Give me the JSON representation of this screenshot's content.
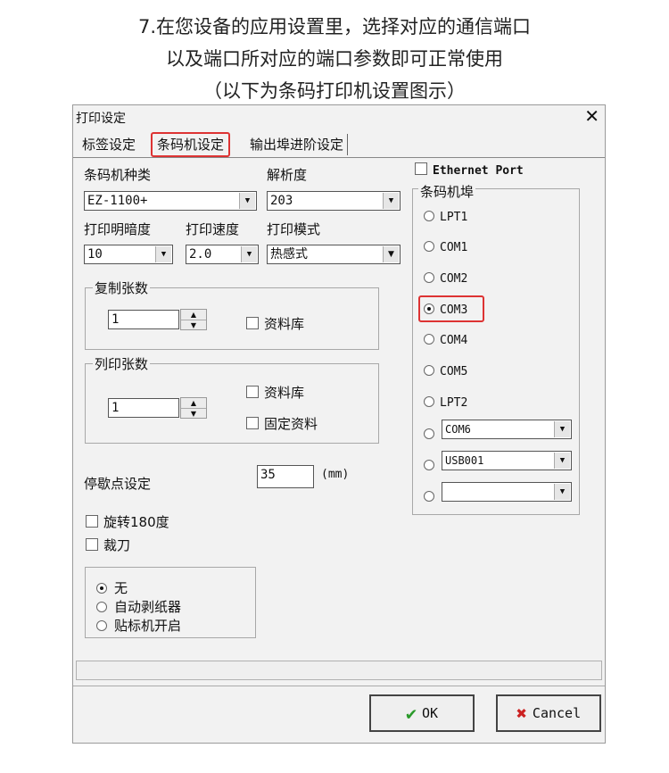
{
  "captions": [
    "7.在您设备的应用设置里，选择对应的通信端口",
    "以及端口所对应的端口参数即可正常使用",
    "（以下为条码打印机设置图示）"
  ],
  "window": {
    "title": "打印设定",
    "close": "✕"
  },
  "tabs": [
    "标签设定",
    "条码机设定",
    "输出埠进阶设定"
  ],
  "fields": {
    "printer_type": {
      "label": "条码机种类",
      "value": "EZ-1100+"
    },
    "resolution": {
      "label": "解析度",
      "value": "203"
    },
    "darkness": {
      "label": "打印明暗度",
      "value": "10"
    },
    "speed": {
      "label": "打印速度",
      "value": "2.0"
    },
    "mode": {
      "label": "打印模式",
      "value": "热感式"
    }
  },
  "copies": {
    "title": "复制张数",
    "value": "1",
    "db_label": "资料库"
  },
  "print_count": {
    "title": "列印张数",
    "value": "1",
    "db_label": "资料库",
    "fixed_label": "固定资料"
  },
  "stop": {
    "label": "停歇点设定",
    "value": "35",
    "unit": "(mm)"
  },
  "options": {
    "rotate": "旋转180度",
    "cutter": "裁刀"
  },
  "post_options": [
    "无",
    "自动剥纸器",
    "贴标机开启"
  ],
  "ports": {
    "ethernet": "Ethernet Port",
    "group_title": "条码机埠",
    "items": [
      "LPT1",
      "COM1",
      "COM2",
      "COM3",
      "COM4",
      "COM5",
      "LPT2"
    ],
    "combo1": "COM6",
    "combo2": "USB001",
    "combo3": ""
  },
  "buttons": {
    "ok": "OK",
    "cancel": "Cancel"
  },
  "icons": {
    "ok": "check-icon",
    "cancel": "x-icon"
  },
  "colors": {
    "highlight": "#dd3333",
    "ok_green": "#2a9a2a",
    "cancel_red": "#cc2222"
  }
}
